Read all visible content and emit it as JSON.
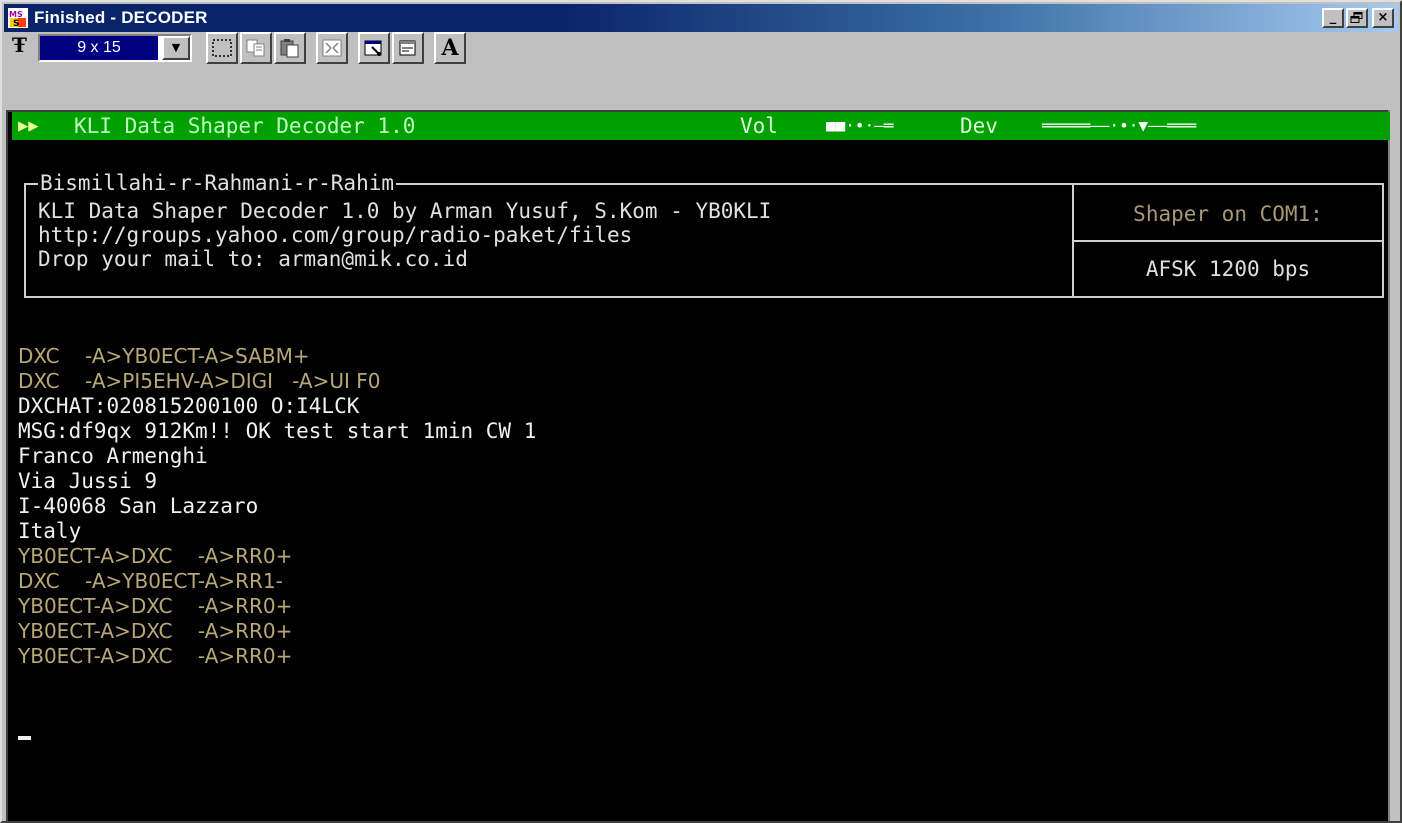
{
  "window": {
    "title": "Finished - DECODER",
    "buttons": {
      "minimize": "_",
      "maximize": "▫",
      "close": "×"
    }
  },
  "toolbar": {
    "font_icon": "Ŧ",
    "font_size_value": "9 x 15",
    "font_size_arrow": "▼",
    "font_button_label": "A"
  },
  "status": {
    "play_icon": "▶▶",
    "title": "KLI Data Shaper Decoder 1.0",
    "vol_label": "Vol",
    "vol_meter": "■■·•·—═",
    "dev_label": "Dev",
    "dev_meter": "═════——·•·▼——═══"
  },
  "info": {
    "legend": "Bismillahi-r-Rahmani-r-Rahim",
    "lines": [
      "KLI Data Shaper Decoder 1.0 by Arman Yusuf, S.Kom - YB0KLI",
      "http://groups.yahoo.com/group/radio-paket/files",
      "Drop your mail to: arman@mik.co.id"
    ],
    "port_label": "Shaper on COM1:",
    "mode_label": "AFSK 1200 bps"
  },
  "log": [
    {
      "kind": "frame",
      "text": "DXC    -A>YB0ECT-A>SABM+"
    },
    {
      "kind": "frame",
      "text": "DXC    -A>PI5EHV-A>DIGI   -A>UI F0"
    },
    {
      "kind": "text",
      "text": "DXCHAT:020815200100 O:I4LCK"
    },
    {
      "kind": "text",
      "text": "MSG:df9qx 912Km!! OK test start 1min CW 1"
    },
    {
      "kind": "text",
      "text": "Franco Armenghi"
    },
    {
      "kind": "text",
      "text": "Via Jussi 9"
    },
    {
      "kind": "text",
      "text": "I-40068 San Lazzaro"
    },
    {
      "kind": "text",
      "text": "Italy"
    },
    {
      "kind": "frame",
      "text": "YB0ECT-A>DXC    -A>RR0+"
    },
    {
      "kind": "frame",
      "text": "DXC    -A>YB0ECT-A>RR1-"
    },
    {
      "kind": "frame",
      "text": "YB0ECT-A>DXC    -A>RR0+"
    },
    {
      "kind": "frame",
      "text": "YB0ECT-A>DXC    -A>RR0+"
    },
    {
      "kind": "frame",
      "text": "YB0ECT-A>DXC    -A>RR0+"
    }
  ],
  "colors": {
    "status_bar": "#00a000",
    "frame_text": "#b8a878",
    "console_text": "#f0f0f0",
    "title_bar": "#0a246a"
  }
}
